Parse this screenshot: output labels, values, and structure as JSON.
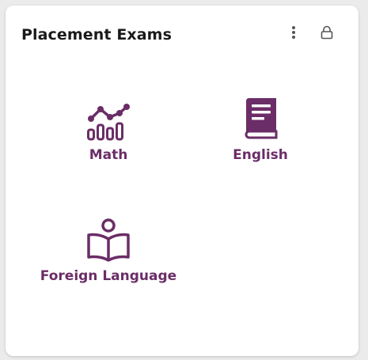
{
  "card": {
    "title": "Placement Exams"
  },
  "actions": [
    {
      "icon": "more-vertical-icon"
    },
    {
      "icon": "lock-icon"
    }
  ],
  "tiles": [
    {
      "label": "Math",
      "icon": "chart-icon"
    },
    {
      "label": "English",
      "icon": "book-icon"
    },
    {
      "label": "Foreign Language",
      "icon": "reader-icon"
    }
  ],
  "colors": {
    "accent": "#6b2d67",
    "title": "#1a1a1a",
    "icon_gray": "#555555",
    "background": "#ebebeb",
    "card": "#ffffff"
  }
}
